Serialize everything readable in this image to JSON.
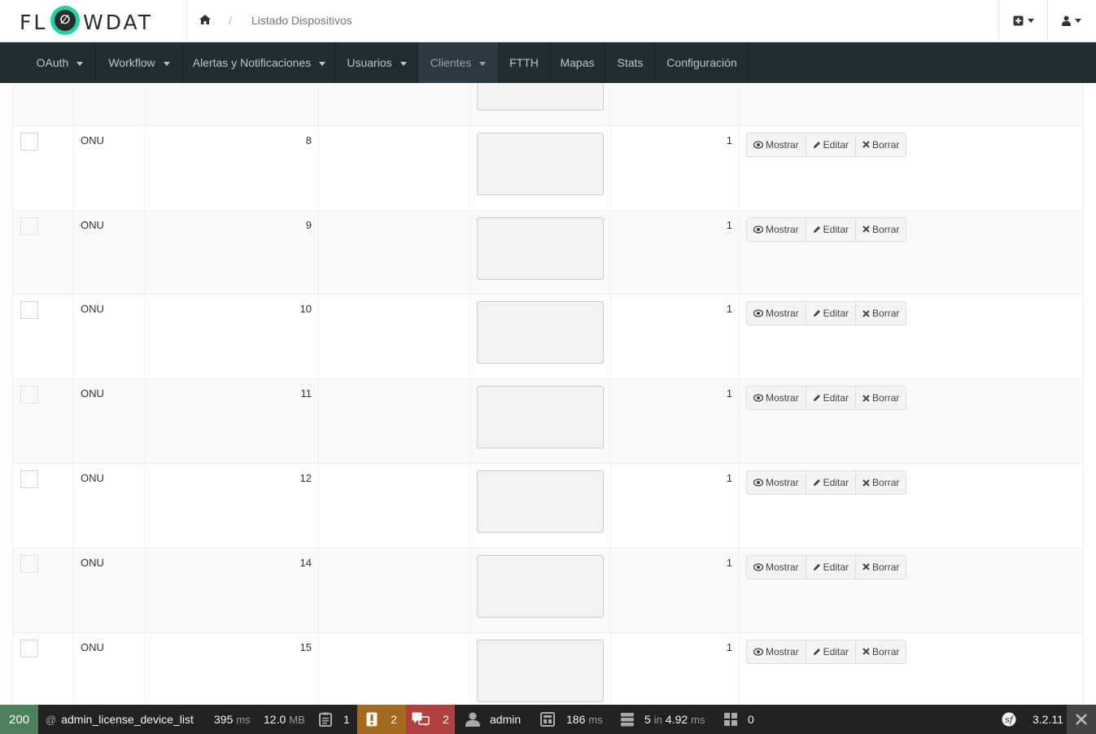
{
  "brand": {
    "logo_text_left": "FL",
    "logo_text_right": "WDAT",
    "logo_symbol": "∅",
    "accent_color": "#1fd3a7"
  },
  "header": {
    "breadcrumb_separator": "/",
    "breadcrumb_current": "Listado Dispositivos",
    "icons": [
      "home-icon",
      "plus-square-icon",
      "user-icon"
    ]
  },
  "nav": {
    "items": [
      {
        "label": "OAuth",
        "dropdown": true
      },
      {
        "label": "Workflow",
        "dropdown": true
      },
      {
        "label": "Alertas y Notificaciones",
        "dropdown": true
      },
      {
        "label": "Usuarios",
        "dropdown": true
      },
      {
        "label": "Clientes",
        "dropdown": true,
        "active": true
      },
      {
        "label": "FTTH",
        "dropdown": false
      },
      {
        "label": "Mapas",
        "dropdown": false
      },
      {
        "label": "Stats",
        "dropdown": false
      },
      {
        "label": "Configuración",
        "dropdown": false
      }
    ]
  },
  "actions": {
    "show": "Mostrar",
    "edit": "Editar",
    "delete": "Borrar"
  },
  "table": {
    "rows": [
      {
        "type": "",
        "id": "",
        "value": "",
        "partial": true
      },
      {
        "type": "ONU",
        "id": "8",
        "value": "1"
      },
      {
        "type": "ONU",
        "id": "9",
        "value": "1"
      },
      {
        "type": "ONU",
        "id": "10",
        "value": "1"
      },
      {
        "type": "ONU",
        "id": "11",
        "value": "1"
      },
      {
        "type": "ONU",
        "id": "12",
        "value": "1"
      },
      {
        "type": "ONU",
        "id": "14",
        "value": "1"
      },
      {
        "type": "ONU",
        "id": "15",
        "value": "1"
      }
    ]
  },
  "debug": {
    "status": "200",
    "route": "admin_license_device_list",
    "time_value": "395",
    "time_unit": "ms",
    "memory_value": "12.0",
    "memory_unit": "MB",
    "logs_count": "1",
    "warnings_count": "2",
    "errors_count": "2",
    "user": "admin",
    "render_time_value": "186",
    "render_time_unit": "ms",
    "db_queries": "5",
    "db_in": "in",
    "db_time": "4.92",
    "db_unit": "ms",
    "forms_count": "0",
    "symfony_version": "3.2.11",
    "colors": {
      "ok": "#4f805d",
      "warning": "#a46a1f",
      "error": "#b0413e"
    }
  }
}
